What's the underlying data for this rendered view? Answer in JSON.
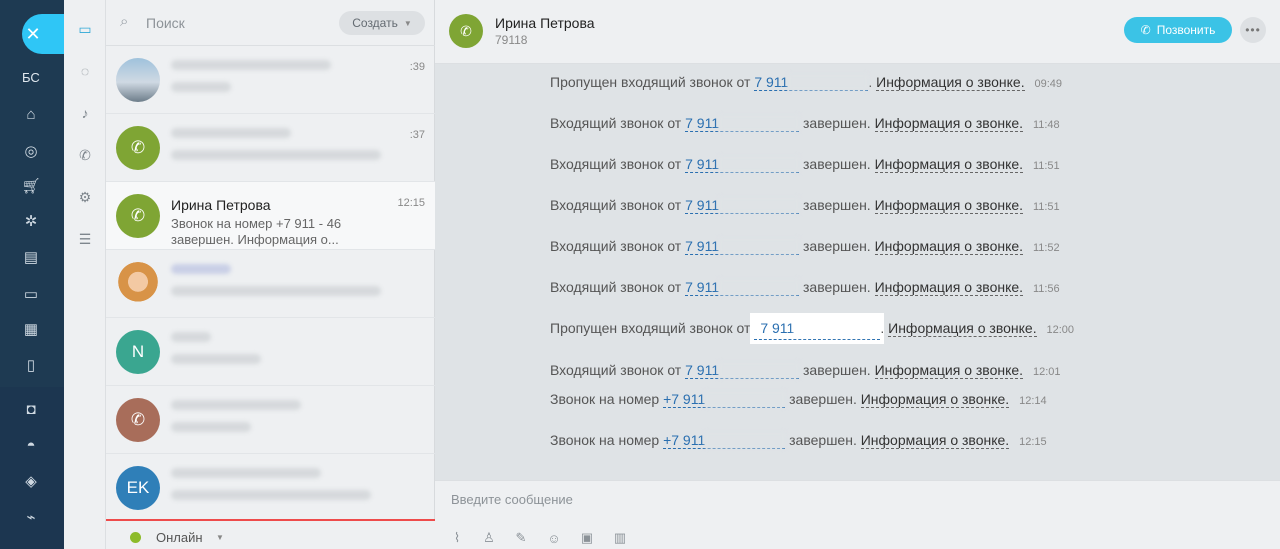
{
  "rail": {
    "label": "БС"
  },
  "search": {
    "placeholder": "Поиск",
    "create_label": "Создать"
  },
  "chats": [
    {
      "time": ":39"
    },
    {
      "time": ":37"
    },
    {
      "name": "Ирина Петрова",
      "time": "12:15",
      "preview": "Звонок на номер +7 911 - 46 завершен. Информация о..."
    },
    {
      "time": ""
    },
    {
      "initials": "N",
      "time": ""
    },
    {
      "time": ""
    },
    {
      "initials": "EK",
      "time": ""
    }
  ],
  "status": {
    "label": "Онлайн"
  },
  "header": {
    "name": "Ирина Петрова",
    "phone": "79118",
    "call_label": "Позвонить"
  },
  "messages": [
    {
      "prefix": "Пропущен входящий звонок от",
      "number": "7 911",
      "suffix": ".",
      "info": "Информация о звонке.",
      "time": "09:49"
    },
    {
      "prefix": "Входящий звонок от",
      "number": "7 911",
      "suffix": "завершен.",
      "info": "Информация о звонке.",
      "time": "11:48"
    },
    {
      "prefix": "Входящий звонок от",
      "number": "7 911",
      "suffix": "завершен.",
      "info": "Информация о звонке.",
      "time": "11:51"
    },
    {
      "prefix": "Входящий звонок от",
      "number": "7 911",
      "suffix": "завершен.",
      "info": "Информация о звонке.",
      "time": "11:51"
    },
    {
      "prefix": "Входящий звонок от",
      "number": "7 911",
      "suffix": "завершен.",
      "info": "Информация о звонке.",
      "time": "11:52"
    },
    {
      "prefix": "Входящий звонок от",
      "number": "7 911",
      "suffix": "завершен.",
      "info": "Информация о звонке.",
      "time": "11:56"
    },
    {
      "prefix": "Пропущен входящий звонок от",
      "number": "7 911",
      "suffix": ".",
      "info": "Информация о звонке.",
      "time": "12:00"
    },
    {
      "prefix": "Входящий звонок от",
      "number": "7 911",
      "suffix": "завершен.",
      "info": "Информация о звонке.",
      "time": "12:01"
    },
    {
      "prefix": "Звонок на номер",
      "number": "+7 911",
      "suffix": "завершен.",
      "info": "Информация о звонке.",
      "time": "12:14"
    },
    {
      "prefix": "Звонок на номер",
      "number": "+7 911",
      "suffix": "завершен.",
      "info": "Информация о звонке.",
      "time": "12:15"
    }
  ],
  "composer": {
    "placeholder": "Введите сообщение"
  },
  "colors": {
    "accent": "#3bc3e6",
    "rail": "#1e3a52",
    "phone_avatar": "#7fa534",
    "online": "#8dbb2a"
  }
}
